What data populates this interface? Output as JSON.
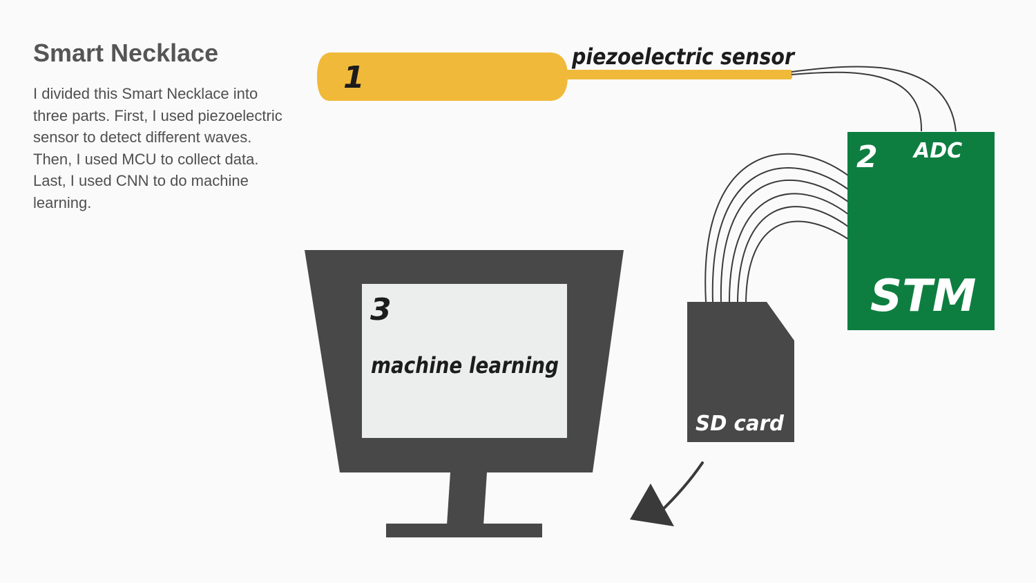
{
  "slide": {
    "title": "Smart Necklace",
    "description": "I divided this Smart Necklace into three parts. First, I used piezoelectric sensor to detect different waves. Then, I used MCU to collect data. Last, I used CNN to do machine learning."
  },
  "diagram": {
    "sensor": {
      "number": "1",
      "label": "piezoelectric sensor",
      "color": "#f0b93a"
    },
    "mcu": {
      "number": "2",
      "adc_label": "ADC",
      "name": "STM",
      "color": "#0e7e40"
    },
    "sd_card": {
      "label": "SD card",
      "color": "#484848"
    },
    "computer": {
      "number": "3",
      "label": "machine learning",
      "color": "#484848",
      "screen_color": "#eceeed"
    }
  }
}
